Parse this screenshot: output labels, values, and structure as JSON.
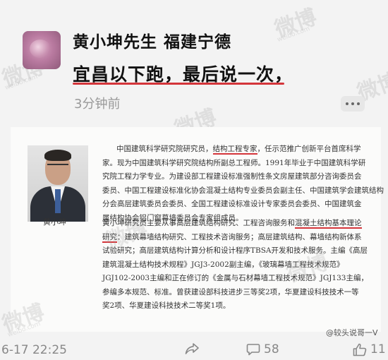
{
  "post": {
    "author": "黄小坤先生 福建宁德",
    "text": "宜昌以下跑，最后说一次，",
    "time": "3分钟前"
  },
  "card": {
    "caption": "黄小坤",
    "bio_lines_1": [
      "中国建筑科学研究院研究员，",
      "结构工程专家",
      "，任示范推广创新平台首席科学",
      "家。现为中国建筑科学研究院结构所副总工程师。1991年毕业于中国建筑科学研",
      "究院工程力学专业。为建设部工程建设标准强制性条文房屋建筑部分咨询委员会",
      "委员、中国工程建设标准化协会混凝土结构专业委员会副主任、中国建筑学会建筑结构",
      "分会高层建筑委员会委员、全国工程建设标准设计专家委员会委员、中国建筑金",
      "属结构协会铝门窗幕墙委员会专家组成员。"
    ],
    "bio_lines_2": [
      "黄小坤研究员主要从事高层建筑结构研究、工程咨询服务和",
      "混凝土结构基本理论",
      "研究",
      "：建筑幕墙结构研究、工程技术咨询服务；高层建筑结构、幕墙结构新体系",
      "试验研究；高层建筑结构计算分析和设计程序TBSA开发和技术服务。主编《高层",
      "建筑混凝土结构技术规程》JGJ3-2002副主编，《玻璃幕墙工程技术规范》",
      "JGJ102-2003主编和正在修订的《金属与石材幕墙工程技术规范》JGJ133主编，",
      "参编多本规范、标准。曾获建设部科技进步三等奖2项，华夏建设科技技术一等",
      "奖2项、华夏建设科技技术二等奖1项。"
    ],
    "source_credit": "@较头说哥一V"
  },
  "watermarks": [
    {
      "text": "微博",
      "sub": "weibo.com"
    }
  ],
  "footer": {
    "time": "6-17 22:25",
    "comments": "58",
    "likes": "11"
  }
}
